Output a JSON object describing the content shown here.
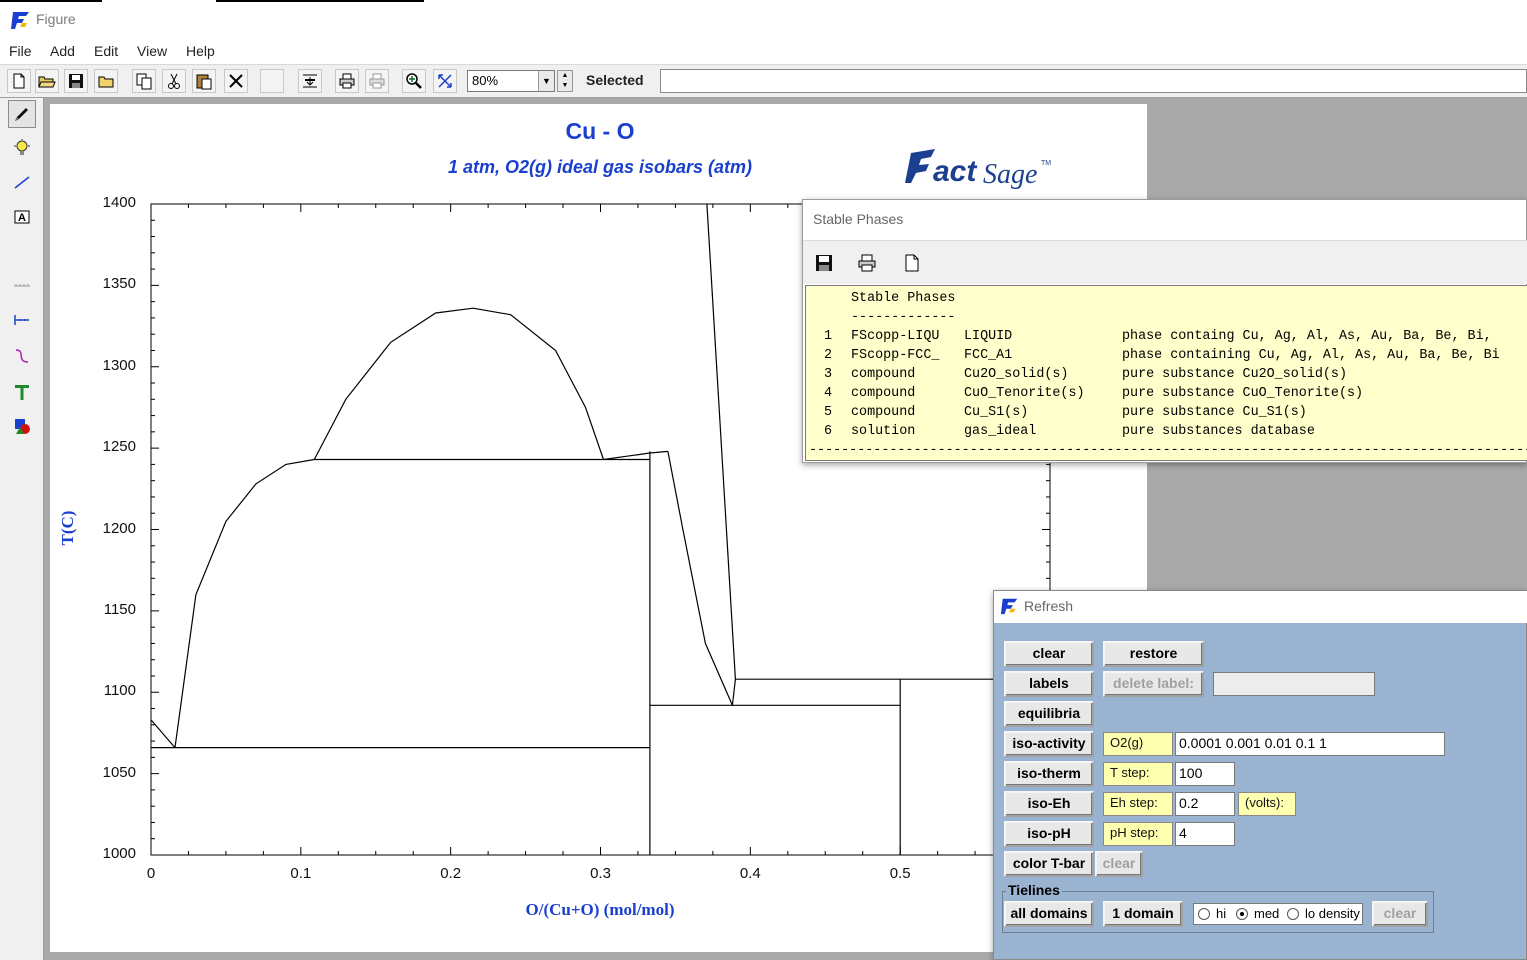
{
  "window": {
    "title": "Figure"
  },
  "menu": [
    "File",
    "Add",
    "Edit",
    "View",
    "Help"
  ],
  "toolbar": {
    "icons": [
      "new-document-icon",
      "open-folder-icon",
      "save-icon",
      "folder-icon",
      "copy-icon",
      "cut-icon",
      "paste-icon",
      "delete-icon",
      "blank-icon",
      "fit-page-icon",
      "print-icon",
      "print-preview-icon",
      "zoom-in-icon",
      "zoom-fit-icon"
    ],
    "zoom_value": "80%",
    "selected_label": "Selected",
    "selected_value": ""
  },
  "left_tools": [
    "pencil-icon",
    "lightbulb-icon",
    "line-icon",
    "text-box-icon",
    "ruler-icon",
    "tick-mark-icon",
    "curve-icon",
    "text-t-icon",
    "shapes-icon"
  ],
  "figure": {
    "title": "Cu - O",
    "subtitle": "1 atm, O2(g) ideal gas isobars (atm)",
    "logo_text": "FactSage",
    "logo_tm": "TM"
  },
  "chart_data": {
    "type": "phase-diagram",
    "title": "Cu - O",
    "subtitle": "1 atm, O2(g) ideal gas isobars (atm)",
    "xlabel": "O/(Cu+O) (mol/mol)",
    "ylabel": "T(C)",
    "xlim": [
      0,
      0.6
    ],
    "ylim": [
      1000,
      1400
    ],
    "xticks": [
      "0",
      "0.1",
      "0.2",
      "0.3",
      "0.4",
      "0.5"
    ],
    "yticks": [
      "1000",
      "1050",
      "1100",
      "1150",
      "1200",
      "1250",
      "1300",
      "1350",
      "1400"
    ],
    "lines": [
      {
        "name": "liquidus-left-a",
        "x": [
          0,
          0.016
        ],
        "y": [
          1083,
          1066
        ]
      },
      {
        "name": "liquidus-left-b",
        "x": [
          0.016,
          0.03,
          0.05,
          0.07,
          0.09,
          0.109
        ],
        "y": [
          1066,
          1160,
          1205,
          1228,
          1240,
          1243
        ]
      },
      {
        "name": "miscibility-gap",
        "x": [
          0.109,
          0.13,
          0.16,
          0.19,
          0.215,
          0.24,
          0.27,
          0.29,
          0.302
        ],
        "y": [
          1243,
          1280,
          1315,
          1333,
          1336,
          1332,
          1310,
          1275,
          1243
        ]
      },
      {
        "name": "monotectic",
        "x": [
          0.109,
          0.333
        ],
        "y": [
          1243,
          1243
        ]
      },
      {
        "name": "liquidus-cu2o-left",
        "x": [
          0.302,
          0.333,
          0.345
        ],
        "y": [
          1243,
          1247,
          1248
        ]
      },
      {
        "name": "liquidus-cu2o-right",
        "x": [
          0.345,
          0.355,
          0.37,
          0.388
        ],
        "y": [
          1248,
          1200,
          1130,
          1092
        ]
      },
      {
        "name": "liquidus-high-o",
        "x": [
          0.371,
          0.39
        ],
        "y": [
          1400,
          1108
        ]
      },
      {
        "name": "liquidus-high-o-b",
        "x": [
          0.388,
          0.39
        ],
        "y": [
          1092,
          1108
        ]
      },
      {
        "name": "eutectic",
        "x": [
          0,
          0.333
        ],
        "y": [
          1066,
          1066
        ]
      },
      {
        "name": "cu2o-line",
        "x": [
          0.333,
          0.333
        ],
        "y": [
          1000,
          1248
        ]
      },
      {
        "name": "eutectic-2",
        "x": [
          0.333,
          0.5
        ],
        "y": [
          1092,
          1092
        ]
      },
      {
        "name": "peritectic",
        "x": [
          0.39,
          0.6
        ],
        "y": [
          1108,
          1108
        ]
      },
      {
        "name": "cuo-line",
        "x": [
          0.5,
          0.5
        ],
        "y": [
          1000,
          1108
        ]
      }
    ]
  },
  "stable_phases": {
    "title": "Stable Phases",
    "toolbar_icons": [
      "save-icon",
      "print-icon",
      "new-document-icon"
    ],
    "header": "Stable Phases",
    "underline": "-------------",
    "rows": [
      {
        "num": "1",
        "source": "FScopp-LIQU",
        "phase": "LIQUID",
        "desc": "phase containg Cu, Ag, Al, As, Au, Ba, Be, Bi,"
      },
      {
        "num": "2",
        "source": "FScopp-FCC_",
        "phase": "FCC_A1",
        "desc": "phase containing Cu, Ag, Al, As, Au, Ba, Be, Bi"
      },
      {
        "num": "3",
        "source": "compound",
        "phase": "Cu2O_solid(s)",
        "desc": "pure substance Cu2O_solid(s)"
      },
      {
        "num": "4",
        "source": "compound",
        "phase": "CuO_Tenorite(s)",
        "desc": "pure substance CuO_Tenorite(s)"
      },
      {
        "num": "5",
        "source": "compound",
        "phase": "Cu_S1(s)",
        "desc": "pure substance Cu_S1(s)"
      },
      {
        "num": "6",
        "source": "solution",
        "phase": "gas_ideal",
        "desc": "pure substances database"
      }
    ],
    "footer": "------------------------------------------------------------------------------------------"
  },
  "refresh": {
    "title": "Refresh",
    "buttons": {
      "clear": "clear",
      "restore": "restore",
      "labels": "labels",
      "delete_label": "delete label:",
      "equilibria": "equilibria",
      "iso_activity": "iso-activity",
      "iso_therm": "iso-therm",
      "iso_eh": "iso-Eh",
      "iso_ph": "iso-pH",
      "color_tbar": "color T-bar",
      "color_clear": "clear",
      "all_domains": "all domains",
      "one_domain": "1 domain",
      "tielines_clear": "clear"
    },
    "delete_label_value": "",
    "iso_activity_species": "O2(g)",
    "iso_activity_values": "0.0001 0.001 0.01 0.1 1",
    "t_step_label": "T step:",
    "t_step_value": "100",
    "eh_step_label": "Eh step:",
    "eh_step_value": "0.2",
    "eh_units": "(volts):",
    "ph_step_label": "pH step:",
    "ph_step_value": "4",
    "tielines_label": "Tielines",
    "density_options": [
      "hi",
      "med",
      "lo density"
    ],
    "density_selected": "med"
  }
}
